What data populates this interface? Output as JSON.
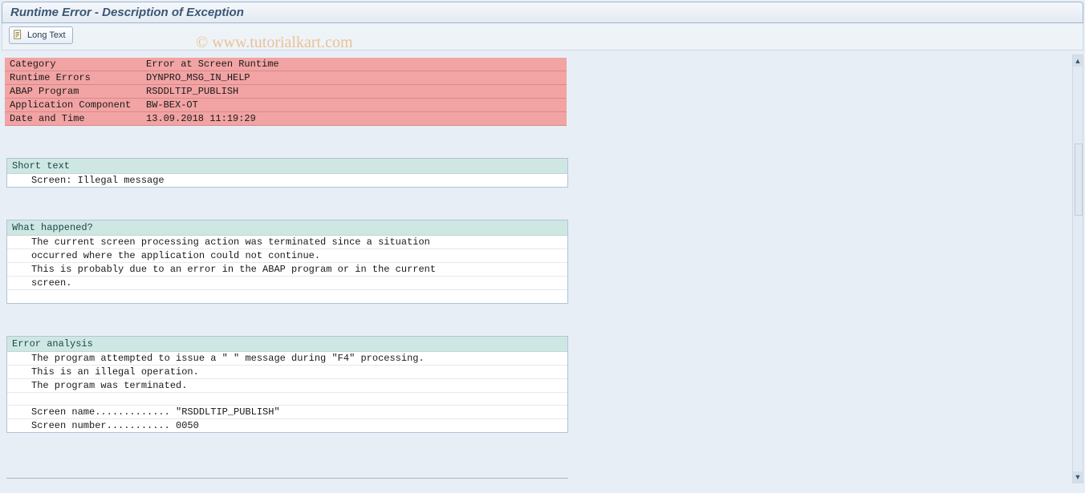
{
  "title": "Runtime Error - Description of Exception",
  "toolbar": {
    "long_text_label": "Long Text"
  },
  "watermark": "© www.tutorialkart.com",
  "header_rows": [
    {
      "label": "Category",
      "value": "Error at Screen Runtime"
    },
    {
      "label": "Runtime Errors",
      "value": "DYNPRO_MSG_IN_HELP"
    },
    {
      "label": "ABAP Program",
      "value": "RSDDLTIP_PUBLISH"
    },
    {
      "label": "Application Component",
      "value": "BW-BEX-OT"
    },
    {
      "label": "Date and Time",
      "value": "13.09.2018 11:19:29"
    }
  ],
  "sections": {
    "short_text": {
      "title": "Short text",
      "lines": [
        "Screen: Illegal message"
      ]
    },
    "what_happened": {
      "title": "What happened?",
      "lines": [
        "The current screen processing action was terminated since a situation",
        "occurred where the application could not continue.",
        "This is probably due to an error in the ABAP program or in the current",
        "screen.",
        ""
      ]
    },
    "error_analysis": {
      "title": "Error analysis",
      "lines": [
        "The program attempted to issue a \" \" message during \"F4\" processing.",
        "This is an illegal operation.",
        "The program was terminated.",
        "",
        "Screen name............. \"RSDDLTIP_PUBLISH\"",
        "Screen number........... 0050"
      ]
    }
  }
}
